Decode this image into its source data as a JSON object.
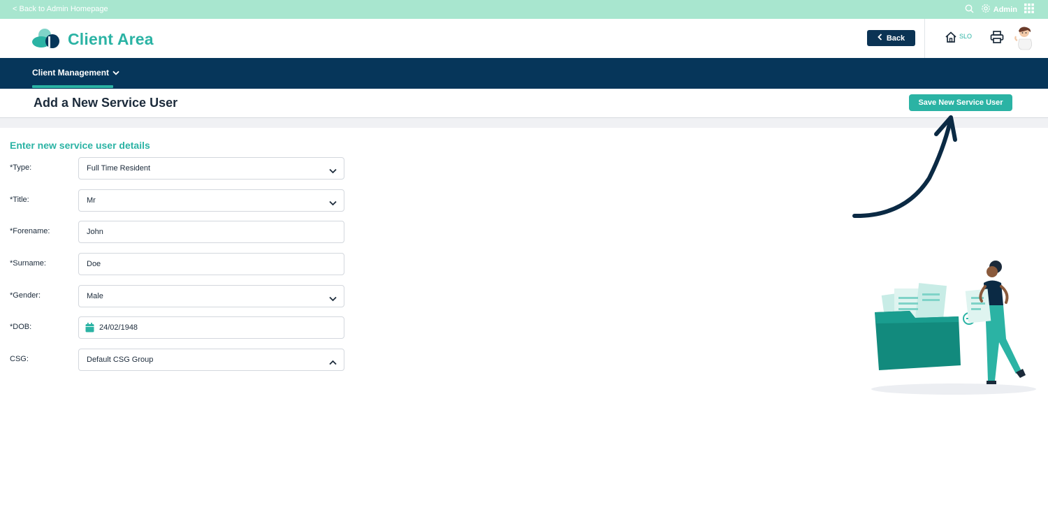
{
  "admin_bar": {
    "back_link": "< Back to Admin Homepage",
    "admin_label": "Admin"
  },
  "header": {
    "brand": "Client Area",
    "back_button": "Back",
    "site_code": "SLO"
  },
  "nav": {
    "items": [
      {
        "label": "Client Management"
      }
    ]
  },
  "page": {
    "title": "Add a New Service User",
    "save_button": "Save New Service User"
  },
  "form": {
    "section_title": "Enter new service user details",
    "fields": [
      {
        "label": "*Type:",
        "value": "Full Time Resident",
        "kind": "select"
      },
      {
        "label": "*Title:",
        "value": "Mr",
        "kind": "select"
      },
      {
        "label": "*Forename:",
        "value": "John",
        "kind": "text"
      },
      {
        "label": "*Surname:",
        "value": "Doe",
        "kind": "text"
      },
      {
        "label": "*Gender:",
        "value": "Male",
        "kind": "select"
      },
      {
        "label": "*DOB:",
        "value": "24/02/1948",
        "kind": "date"
      },
      {
        "label": "CSG:",
        "value": "Default CSG Group",
        "kind": "select-open"
      }
    ]
  },
  "colors": {
    "teal": "#2bb3a4",
    "navy": "#06365a",
    "mint": "#a8e6cf"
  },
  "icons": [
    "search-icon",
    "gear-icon",
    "apps-grid-icon",
    "logo-cloud-icon",
    "chevron-left-icon",
    "home-icon",
    "print-icon",
    "avatar",
    "chevron-down-icon",
    "chevron-up-icon",
    "calendar-icon"
  ]
}
